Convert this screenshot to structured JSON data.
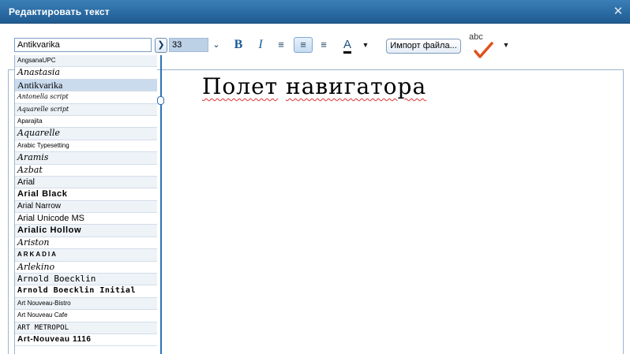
{
  "window": {
    "title": "Редактировать текст"
  },
  "toolbar": {
    "font_value": "Antikvarika",
    "size_value": "33",
    "bold_label": "B",
    "italic_label": "I",
    "color_label": "A",
    "import_label": "Импорт файла...",
    "spell_label": "abc",
    "accent_color": "#1c5a97",
    "spell_check_color": "#e0501e"
  },
  "font_list": {
    "items": [
      "AngsanaUPC",
      "Anastasia",
      "Antikvarika",
      "Antonella script",
      "Aquarelle script",
      "Aparajita",
      "Aquarelle",
      "Arabic Typesetting",
      "Aramis",
      "Azbat",
      "Arial",
      "Arial Black",
      "Arial Narrow",
      "Arial Unicode MS",
      "Arialic Hollow",
      "Ariston",
      "ARKADIA",
      "Arlekino",
      "Arnold Boecklin",
      "Arnold Boecklin Initial",
      "Art Nouveau-Bistro",
      "Art Nouveau Cafe",
      "ART METROPOL",
      "Art-Nouveau 1116"
    ],
    "selected": "Antikvarika"
  },
  "editor": {
    "text_word1": "Полет",
    "text_word2": "навигатора"
  }
}
